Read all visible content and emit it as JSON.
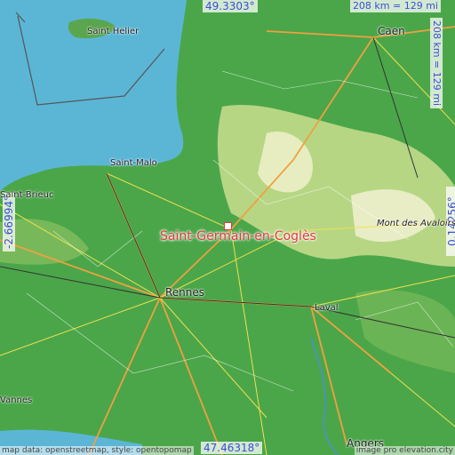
{
  "map": {
    "coordinates": {
      "north": "49.3303°",
      "south": "47.46318°",
      "west": "-2.66994°",
      "east": "0.14256°"
    },
    "scale_horizontal": "208 km = 129 mi",
    "scale_vertical": "208 km = 129 mi",
    "highlight": "Saint-Germain-en-Coglès",
    "cities": [
      {
        "name": "Saint Helier"
      },
      {
        "name": "Caen"
      },
      {
        "name": "Saint-Malo"
      },
      {
        "name": "Saint-Brieuc"
      },
      {
        "name": "Mont des Avaloirs"
      },
      {
        "name": "Rennes"
      },
      {
        "name": "Laval"
      },
      {
        "name": "Vannes"
      },
      {
        "name": "Angers"
      }
    ],
    "credit_left": "map data: openstreetmap, style: opentopomap",
    "credit_right": "image pro   elevation.city",
    "colors": {
      "sea": "#5bb6d6",
      "lowland": "#4ba64a",
      "upland": "#d7e4a2",
      "marker": "#e23a3a"
    }
  }
}
